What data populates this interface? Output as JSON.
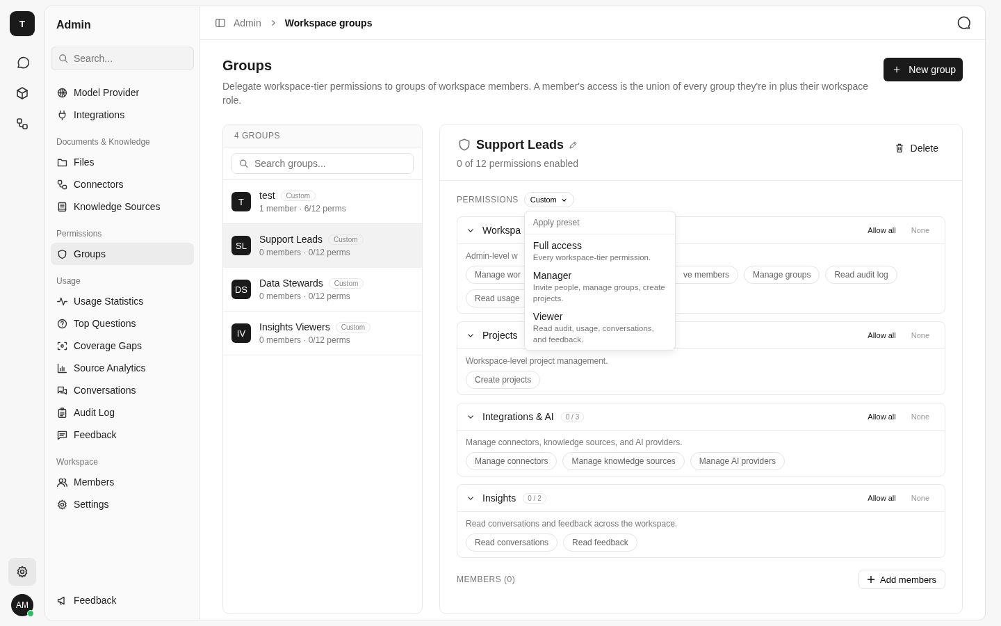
{
  "rail": {
    "workspace_initial": "T",
    "buttons": [
      {
        "selected": false
      },
      {
        "selected": false
      },
      {
        "selected": false
      }
    ],
    "settings": {
      "selected": true
    },
    "user_initials": "AM",
    "online": true
  },
  "sidebar": {
    "title": "Admin",
    "search": {
      "placeholder": "Search..."
    },
    "sections": [
      {
        "items": [
          {
            "label": "Model Provider",
            "selected": false
          },
          {
            "label": "Integrations",
            "selected": false
          }
        ]
      },
      {
        "heading": "Documents & Knowledge",
        "items": [
          {
            "label": "Files",
            "selected": false
          },
          {
            "label": "Connectors",
            "selected": false
          },
          {
            "label": "Knowledge Sources",
            "selected": false
          }
        ]
      },
      {
        "heading": "Permissions",
        "items": [
          {
            "label": "Groups",
            "selected": true
          }
        ]
      },
      {
        "heading": "Usage",
        "items": [
          {
            "label": "Usage Statistics",
            "selected": false
          },
          {
            "label": "Top Questions",
            "selected": false
          },
          {
            "label": "Coverage Gaps",
            "selected": false
          },
          {
            "label": "Source Analytics",
            "selected": false
          },
          {
            "label": "Conversations",
            "selected": false
          },
          {
            "label": "Audit Log",
            "selected": false
          },
          {
            "label": "Feedback",
            "selected": false
          }
        ]
      },
      {
        "heading": "Workspace",
        "items": [
          {
            "label": "Members",
            "selected": false
          },
          {
            "label": "Settings",
            "selected": false
          }
        ]
      }
    ],
    "footer": "Feedback"
  },
  "breadcrumb": [
    "Admin",
    "Workspace groups"
  ],
  "page": {
    "title": "Groups",
    "description": "Delegate workspace-tier permissions to groups of workspace members. A member's access is the union of every group they're in plus their workspace role.",
    "new_button": "New group"
  },
  "groups_panel": {
    "count_label": "4 GROUPS",
    "search": {
      "placeholder": "Search groups..."
    },
    "groups": [
      {
        "initials": "T",
        "name": "test",
        "tag": "Custom",
        "meta": "1 member · 6/12 perms",
        "selected": false
      },
      {
        "initials": "SL",
        "name": "Support Leads",
        "tag": "Custom",
        "meta": "0 members · 0/12 perms",
        "selected": true
      },
      {
        "initials": "DS",
        "name": "Data Stewards",
        "tag": "Custom",
        "meta": "0 members · 0/12 perms",
        "selected": false
      },
      {
        "initials": "IV",
        "name": "Insights Viewers",
        "tag": "Custom",
        "meta": "0 members · 0/12 perms",
        "selected": false
      }
    ]
  },
  "detail": {
    "title": "Support Leads",
    "subtitle": "0 of 12 permissions enabled",
    "delete_button": "Delete",
    "permissions_label": "PERMISSIONS",
    "preset_button": "Custom",
    "sections": [
      {
        "title": "Workspa",
        "expanded": true,
        "allow": "Allow all",
        "none": "None",
        "description": "Admin-level w",
        "chips": [
          {
            "label": "Manage wor",
            "kind": "clip-end"
          },
          {
            "label": "ve members",
            "kind": "clip-start"
          },
          {
            "label": "Manage groups",
            "kind": "full"
          },
          {
            "label": "Read audit log",
            "kind": "full"
          },
          {
            "label": "Read usage",
            "kind": "clip-end"
          }
        ]
      },
      {
        "title": "Projects",
        "expanded": true,
        "allow": "Allow all",
        "none": "None",
        "description": "Workspace-level project management.",
        "chips": [
          {
            "label": "Create projects",
            "kind": "full"
          }
        ]
      },
      {
        "title": "Integrations & AI",
        "count": "0 / 3",
        "expanded": true,
        "allow": "Allow all",
        "none": "None",
        "description": "Manage connectors, knowledge sources, and AI providers.",
        "chips": [
          {
            "label": "Manage connectors",
            "kind": "full"
          },
          {
            "label": "Manage knowledge sources",
            "kind": "full"
          },
          {
            "label": "Manage AI providers",
            "kind": "full"
          }
        ]
      },
      {
        "title": "Insights",
        "count": "0 / 2",
        "expanded": true,
        "allow": "Allow all",
        "none": "None",
        "description": "Read conversations and feedback across the workspace.",
        "chips": [
          {
            "label": "Read conversations",
            "kind": "full"
          },
          {
            "label": "Read feedback",
            "kind": "full"
          }
        ]
      }
    ],
    "members_label": "MEMBERS (0)",
    "add_members_button": "Add members"
  },
  "preset_menu": {
    "open": true,
    "heading": "Apply preset",
    "items": [
      {
        "title": "Full access",
        "description": "Every workspace-tier permission."
      },
      {
        "title": "Manager",
        "description": "Invite people, manage groups, create projects."
      },
      {
        "title": "Viewer",
        "description": "Read audit, usage, conversations, and feedback."
      }
    ]
  }
}
